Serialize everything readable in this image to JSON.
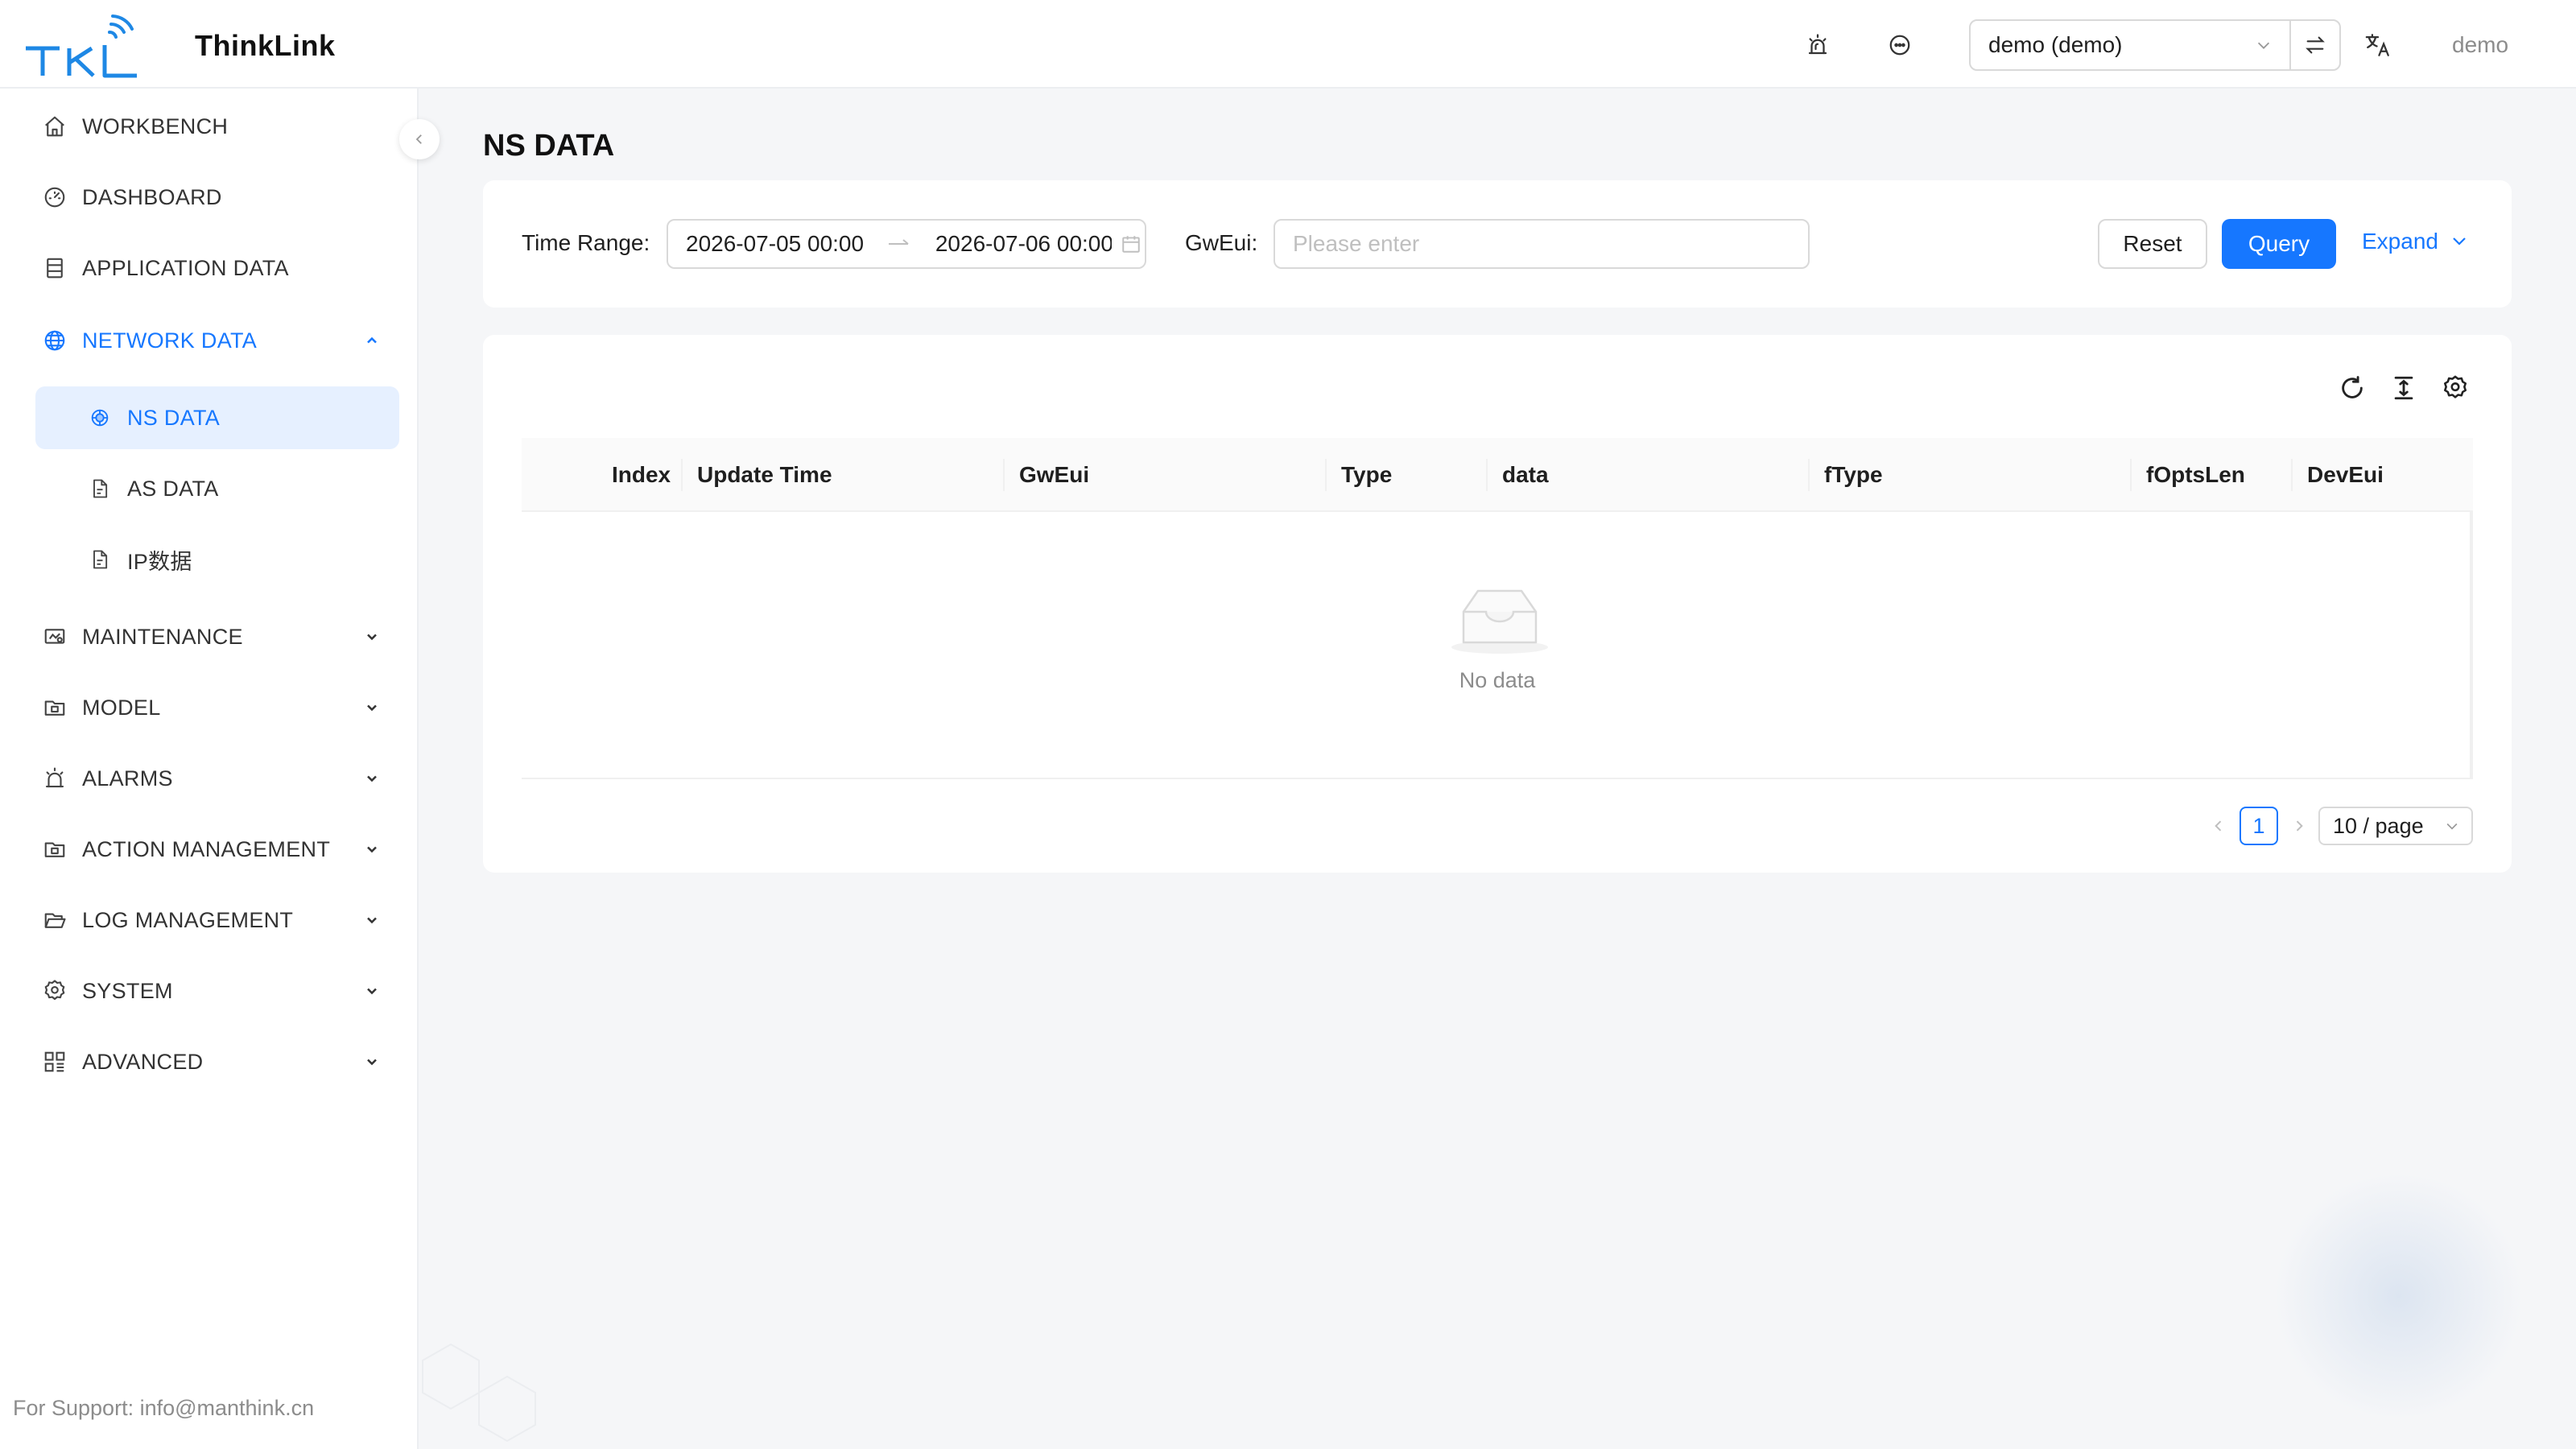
{
  "header": {
    "brand_name": "ThinkLink",
    "tenant_value": "demo (demo)",
    "username": "demo"
  },
  "sidebar": {
    "items": [
      {
        "label": "WORKBENCH",
        "icon": "home-icon"
      },
      {
        "label": "DASHBOARD",
        "icon": "dashboard-icon"
      },
      {
        "label": "APPLICATION DATA",
        "icon": "database-icon"
      },
      {
        "label": "NETWORK DATA",
        "icon": "globe-icon",
        "expanded": true,
        "children": [
          {
            "label": "NS DATA",
            "icon": "radio-icon",
            "active": true
          },
          {
            "label": "AS DATA",
            "icon": "file-icon"
          },
          {
            "label": "IP数据",
            "icon": "file-icon"
          }
        ]
      },
      {
        "label": "MAINTENANCE",
        "icon": "monitor-icon"
      },
      {
        "label": "MODEL",
        "icon": "folder-icon"
      },
      {
        "label": "ALARMS",
        "icon": "alarm-icon"
      },
      {
        "label": "ACTION MANAGEMENT",
        "icon": "folder-icon"
      },
      {
        "label": "LOG MANAGEMENT",
        "icon": "folder-open-icon"
      },
      {
        "label": "SYSTEM",
        "icon": "gear-icon"
      },
      {
        "label": "ADVANCED",
        "icon": "grid-icon"
      }
    ],
    "support_text": "For Support: info@manthink.cn"
  },
  "page": {
    "title": "NS DATA"
  },
  "filters": {
    "time_range_label": "Time Range",
    "range_start": "2026-07-05 00:00",
    "range_end": "2026-07-06 00:00",
    "gweui_label": "GwEui",
    "gweui_placeholder": "Please enter",
    "reset_label": "Reset",
    "query_label": "Query",
    "expand_label": "Expand"
  },
  "table": {
    "columns": [
      "Index",
      "Update Time",
      "GwEui",
      "Type",
      "data",
      "fType",
      "fOptsLen",
      "DevEui"
    ],
    "rows": [],
    "empty_text": "No data"
  },
  "pagination": {
    "current_page": "1",
    "page_size": "10 / page"
  },
  "colors": {
    "accent": "#1677ff",
    "active_bg": "#e6f0ff",
    "page_bg": "#f5f6f8"
  }
}
